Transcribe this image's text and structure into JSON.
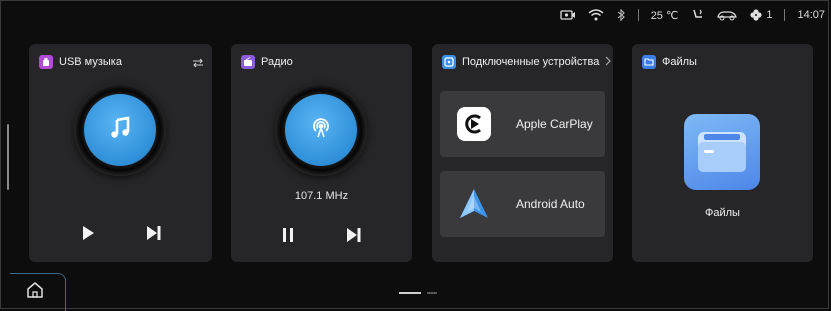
{
  "status": {
    "temperature": "25 ℃",
    "notification_count": "1",
    "time": "14:07"
  },
  "cards": {
    "usb": {
      "title": "USB музыка",
      "accent": "#b44ad6"
    },
    "radio": {
      "title": "Радио",
      "frequency": "107.1 MHz",
      "accent": "#8a5cd8"
    },
    "devices": {
      "title": "Подключенные устройства",
      "items": [
        {
          "label": "Apple CarPlay",
          "icon": "carplay-icon"
        },
        {
          "label": "Android Auto",
          "icon": "android-auto-icon"
        }
      ],
      "accent": "#3a8ee6"
    },
    "files": {
      "title": "Файлы",
      "label": "Файлы",
      "accent": "#3a7ee6"
    }
  },
  "icons": [
    "camera-icon",
    "wifi-icon",
    "bluetooth-icon",
    "seat-heat-icon",
    "car-icon",
    "fan-icon",
    "home-icon",
    "music-note-icon",
    "radio-antenna-icon",
    "play-icon",
    "pause-icon",
    "next-icon",
    "repeat-icon",
    "folder-icon"
  ]
}
